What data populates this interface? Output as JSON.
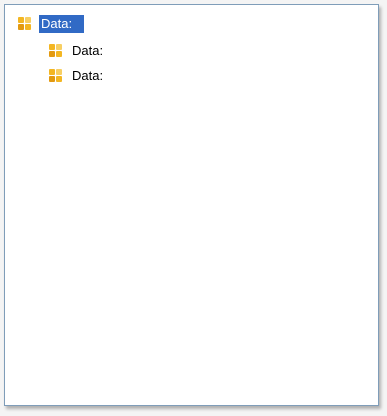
{
  "tree": {
    "selected_node": "root",
    "nodes": [
      {
        "id": "root",
        "label": "Data:",
        "icon": "data-grid-icon",
        "level": 0,
        "selected": true
      },
      {
        "id": "child1",
        "label": "Data:",
        "icon": "data-grid-icon",
        "level": 1,
        "selected": false
      },
      {
        "id": "child2",
        "label": "Data:",
        "icon": "data-grid-icon",
        "level": 1,
        "selected": false
      }
    ]
  },
  "colors": {
    "selection_background": "#316ac5",
    "selection_text": "#ffffff",
    "icon_primary": "#f3b622",
    "panel_border": "#7f9db9"
  }
}
